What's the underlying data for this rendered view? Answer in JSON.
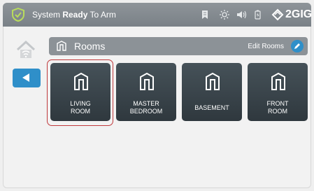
{
  "status": {
    "prefix": "System ",
    "bold": "Ready",
    "suffix": " To Arm"
  },
  "brand": {
    "name": "2GIG",
    "accent": "#2f8fc9"
  },
  "icons": [
    "shield-check-icon",
    "bookmark-icon",
    "brightness-icon",
    "volume-icon",
    "battery-icon",
    "2gig-logo-icon",
    "home-wifi-icon",
    "back-arrow-icon",
    "room-icon",
    "edit-pencil-icon"
  ],
  "header": {
    "title": "Rooms",
    "edit_label": "Edit Rooms"
  },
  "rooms": [
    {
      "line1": "LIVING",
      "line2": "ROOM",
      "selected": true
    },
    {
      "line1": "MASTER",
      "line2": "BEDROOM",
      "selected": false
    },
    {
      "line1": "BASEMENT",
      "line2": "",
      "selected": false
    },
    {
      "line1": "FRONT",
      "line2": "ROOM",
      "selected": false
    }
  ],
  "colors": {
    "topbar": "#7f868c",
    "tile": "#333d43",
    "selection": "#c0393b",
    "accent": "#2f8fc9"
  }
}
